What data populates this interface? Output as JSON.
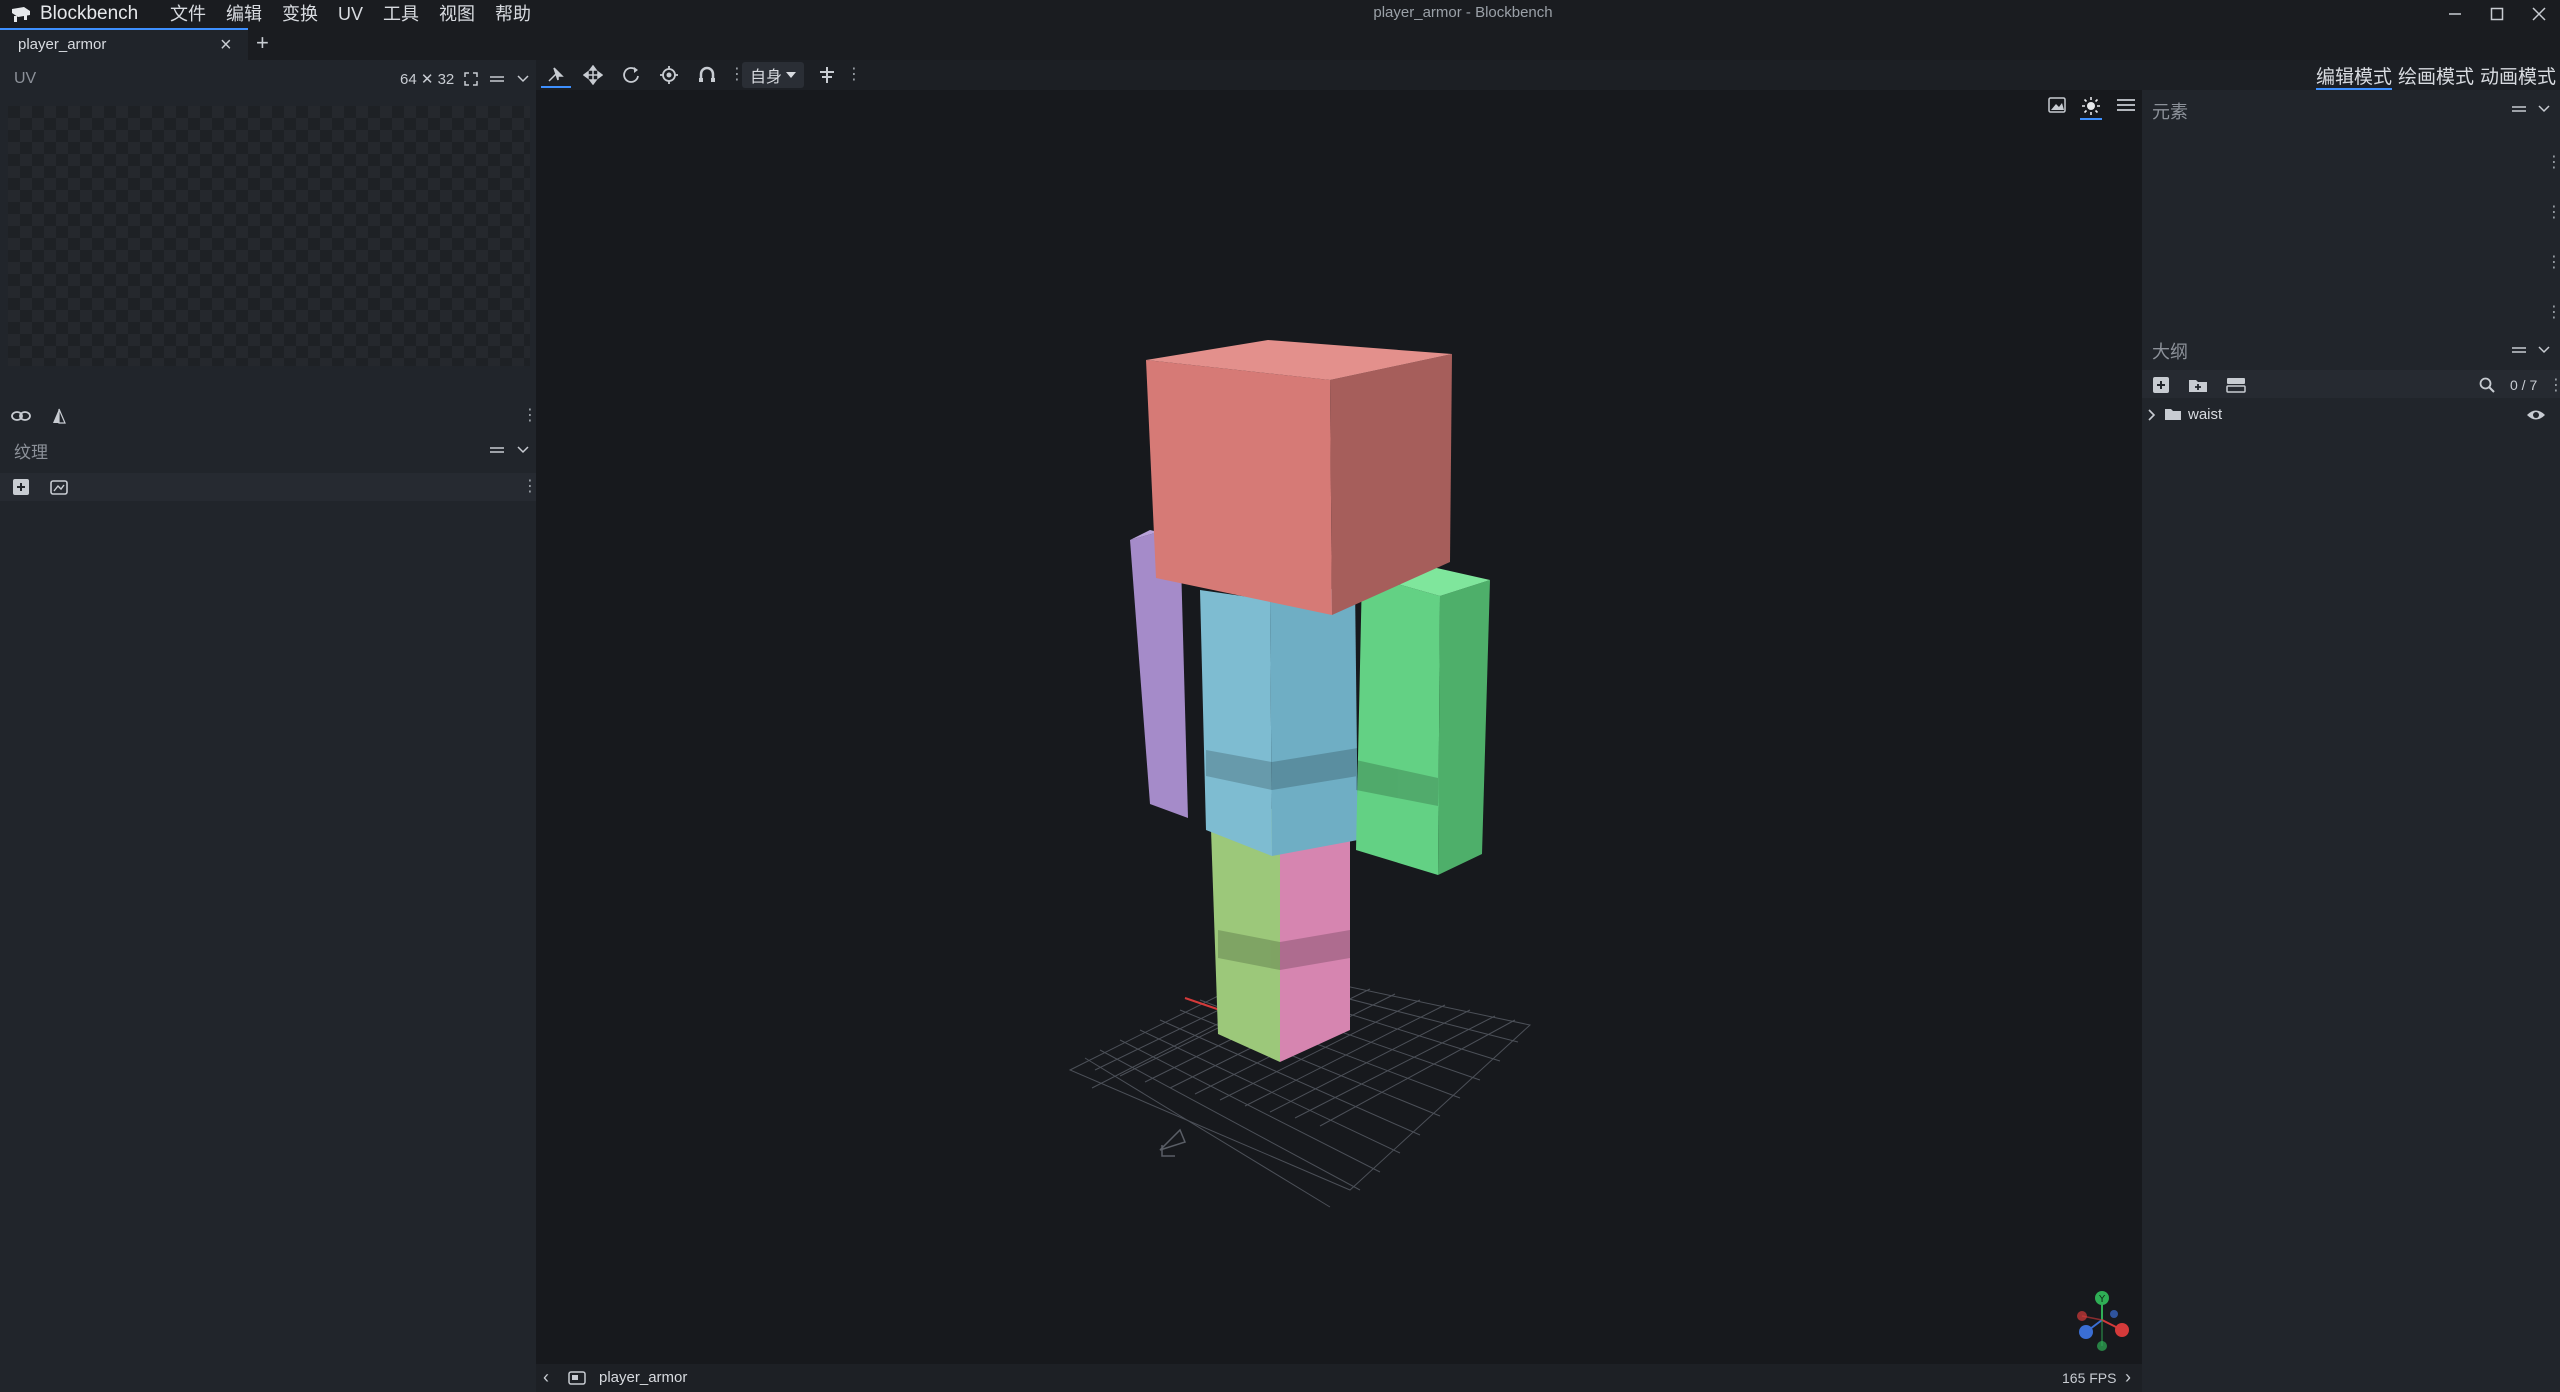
{
  "app": {
    "name": "Blockbench",
    "window_title": "player_armor - Blockbench"
  },
  "menu": [
    "文件",
    "编辑",
    "变换",
    "UV",
    "工具",
    "视图",
    "帮助"
  ],
  "tabs": [
    {
      "label": "player_armor",
      "close_icon": "close-icon"
    }
  ],
  "uv_panel": {
    "title": "UV",
    "size_label": "64 ✕ 32"
  },
  "texture_panel": {
    "title": "纹理"
  },
  "toolbar": {
    "space_label": "自身"
  },
  "modes": {
    "edit": "编辑模式",
    "paint": "绘画模式",
    "animate": "动画模式"
  },
  "elements_panel": {
    "title": "元素"
  },
  "outliner": {
    "title": "大纲",
    "count": "0 / 7",
    "items": [
      {
        "label": "waist",
        "icon": "folder-icon"
      }
    ]
  },
  "statusbar": {
    "project": "player_armor",
    "fps": "165 FPS"
  },
  "colors": {
    "accent": "#3e90ff",
    "head": "#d67a76",
    "arm_left": "#a58bc9",
    "torso": "#7ebcd1",
    "arm_right": "#63d184",
    "leg_left": "#9cc87a",
    "leg_right": "#d685b0"
  }
}
